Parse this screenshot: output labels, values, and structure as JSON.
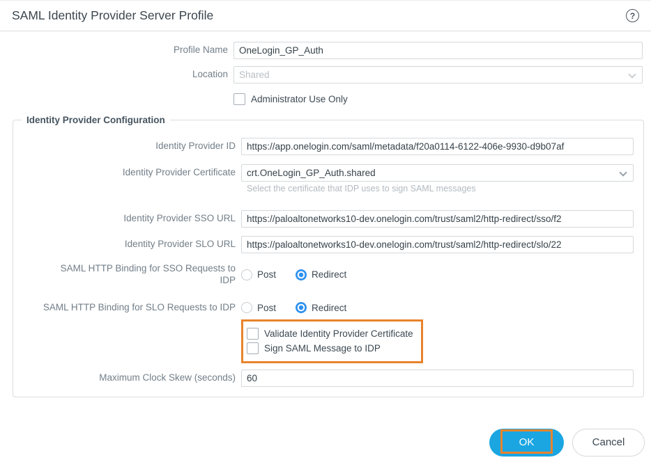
{
  "header": {
    "title": "SAML Identity Provider Server Profile",
    "help_glyph": "?"
  },
  "general": {
    "profile_name": {
      "label": "Profile Name",
      "value": "OneLogin_GP_Auth"
    },
    "location": {
      "label": "Location",
      "value": "Shared",
      "disabled": true
    },
    "admin_use_only": {
      "label": "Administrator Use Only",
      "checked": false
    }
  },
  "idp_config": {
    "legend": "Identity Provider Configuration",
    "identity_provider_id": {
      "label": "Identity Provider ID",
      "value": "https://app.onelogin.com/saml/metadata/f20a0114-6122-406e-9930-d9b07af"
    },
    "identity_provider_certificate": {
      "label": "Identity Provider Certificate",
      "value": "crt.OneLogin_GP_Auth.shared",
      "hint": "Select the certificate that IDP uses to sign SAML messages"
    },
    "sso_url": {
      "label": "Identity Provider SSO URL",
      "value": "https://paloaltonetworks10-dev.onelogin.com/trust/saml2/http-redirect/sso/f2"
    },
    "slo_url": {
      "label": "Identity Provider SLO URL",
      "value": "https://paloaltonetworks10-dev.onelogin.com/trust/saml2/http-redirect/slo/22"
    },
    "sso_binding": {
      "label": "SAML HTTP Binding for SSO Requests to IDP",
      "options": [
        "Post",
        "Redirect"
      ],
      "selected": "Redirect"
    },
    "slo_binding": {
      "label": "SAML HTTP Binding for SLO Requests to IDP",
      "options": [
        "Post",
        "Redirect"
      ],
      "selected": "Redirect"
    },
    "validate_idp_cert": {
      "label": "Validate Identity Provider Certificate",
      "checked": false
    },
    "sign_saml_message": {
      "label": "Sign SAML Message to IDP",
      "checked": false
    },
    "max_clock_skew": {
      "label": "Maximum Clock Skew (seconds)",
      "value": "60"
    }
  },
  "footer": {
    "ok_label": "OK",
    "cancel_label": "Cancel"
  },
  "colors": {
    "accent_blue": "#1ba6e2",
    "radio_blue": "#2e91f0",
    "highlight_orange": "#e8832c"
  }
}
